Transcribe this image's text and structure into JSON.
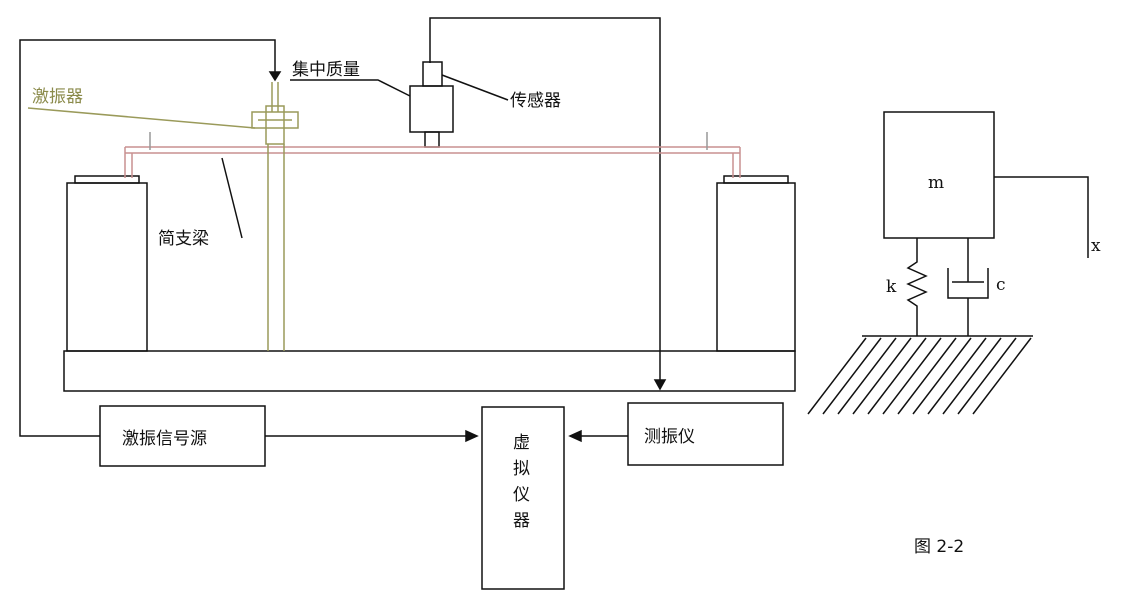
{
  "setup": {
    "shaker_label": "激振器",
    "mass_label": "集中质量",
    "sensor_label": "传感器",
    "support_label": "简支梁",
    "signal_source_label": "激振信号源",
    "vibrometer_label": "测振仪",
    "virtual_instrument_label": "虚拟仪器"
  },
  "model": {
    "mass_symbol": "m",
    "spring_symbol": "k",
    "damper_symbol": "c",
    "displacement_symbol": "x"
  },
  "figure": {
    "caption": "图 2-2"
  },
  "colors": {
    "line": "#111111",
    "beam": "#c89090",
    "shaker": "#9a9a5a"
  }
}
